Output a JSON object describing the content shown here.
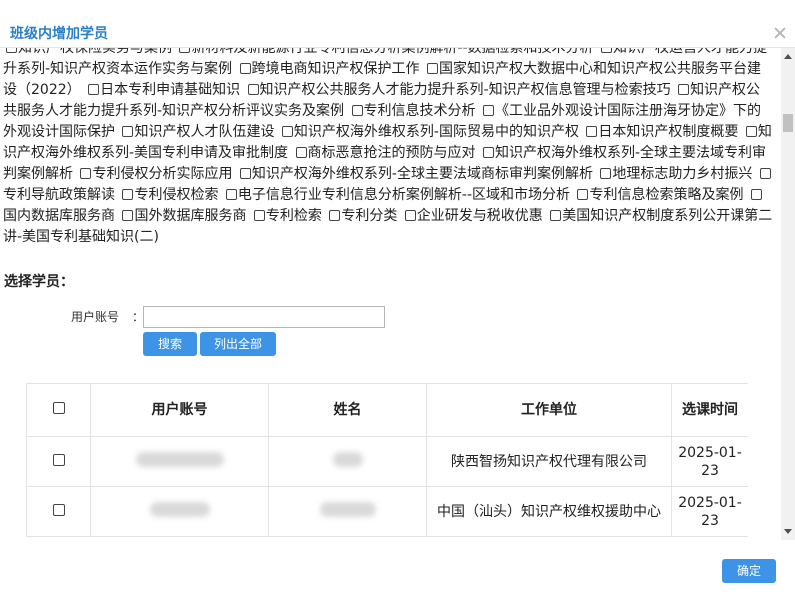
{
  "dialog": {
    "title": "班级内增加学员",
    "confirm_label": "确定"
  },
  "courses": [
    "知识产权保险实务与案例",
    "新材料及新能源行业专利信息分析案例解析--数据检索和技术分析",
    "知识产权运营人才能力提升系列-知识产权资本运作实务与案例",
    "跨境电商知识产权保护工作",
    "国家知识产权大数据中心和知识产权公共服务平台建设（2022）",
    "日本专利申请基础知识",
    "知识产权公共服务人才能力提升系列-知识产权信息管理与检索技巧",
    "知识产权公共服务人才能力提升系列-知识产权分析评议实务及案例",
    "专利信息技术分析",
    "《工业品外观设计国际注册海牙协定》下的外观设计国际保护",
    "知识产权人才队伍建设",
    "知识产权海外维权系列-国际贸易中的知识产权",
    "日本知识产权制度概要",
    "知识产权海外维权系列-美国专利申请及审批制度",
    "商标恶意抢注的预防与应对",
    "知识产权海外维权系列-全球主要法域专利审判案例解析",
    "专利侵权分析实际应用",
    "知识产权海外维权系列-全球主要法域商标审判案例解析",
    "地理标志助力乡村振兴",
    "专利导航政策解读",
    "专利侵权检索",
    "电子信息行业专利信息分析案例解析--区域和市场分析",
    "专利信息检索策略及案例",
    "国内数据库服务商",
    "国外数据库服务商",
    "专利检索",
    "专利分类",
    "企业研发与税收优惠",
    "美国知识产权制度系列公开课第二讲-美国专利基础知识(二)"
  ],
  "select_section": {
    "title": "选择学员：",
    "account_label": "用户账号",
    "colon": "：",
    "account_value": "",
    "search_label": "搜索",
    "list_all_label": "列出全部"
  },
  "table": {
    "headers": [
      "用户账号",
      "姓名",
      "工作单位",
      "选课时间"
    ],
    "rows": [
      {
        "account": "",
        "name": "",
        "unit": "陕西智扬知识产权代理有限公司",
        "time": "2025-01-23"
      },
      {
        "account": "",
        "name": "",
        "unit": "中国（汕头）知识产权维权援助中心",
        "time": "2025-01-23"
      }
    ]
  }
}
